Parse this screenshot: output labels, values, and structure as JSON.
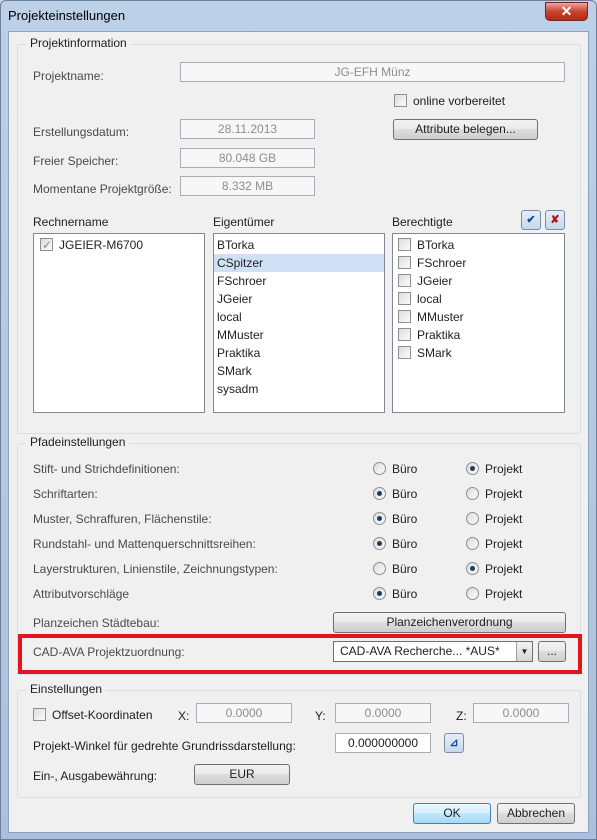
{
  "window": {
    "title": "Projekteinstellungen",
    "close_glyph": "✕"
  },
  "projektinfo": {
    "legend": "Projektinformation",
    "projektname_label": "Projektname:",
    "projektname_value": "JG-EFH Münz",
    "online_label": "online vorbereitet",
    "erstellungsdatum_label": "Erstellungsdatum:",
    "erstellungsdatum_value": "28.11.2013",
    "attribute_button": "Attribute belegen...",
    "freier_speicher_label": "Freier Speicher:",
    "freier_speicher_value": "80.048 GB",
    "projektgroesse_label": "Momentane Projektgröße:",
    "projektgroesse_value": "8.332 MB",
    "rechnername_header": "Rechnername",
    "eigentuemer_header": "Eigentümer",
    "berechtigte_header": "Berechtigte",
    "rechner": [
      "JGEIER-M6700"
    ],
    "eigentuemer": [
      "BTorka",
      "CSpitzer",
      "FSchroer",
      "JGeier",
      "local",
      "MMuster",
      "Praktika",
      "SMark",
      "sysadm"
    ],
    "eigentuemer_selected": "CSpitzer",
    "berechtigte": [
      "BTorka",
      "FSchroer",
      "JGeier",
      "local",
      "MMuster",
      "Praktika",
      "SMark"
    ]
  },
  "pfade": {
    "legend": "Pfadeinstellungen",
    "option_buero": "Büro",
    "option_projekt": "Projekt",
    "rows": [
      {
        "label": "Stift- und Strichdefinitionen:",
        "selected": "Projekt"
      },
      {
        "label": "Schriftarten:",
        "selected": "Büro"
      },
      {
        "label": "Muster, Schraffuren, Flächenstile:",
        "selected": "Büro"
      },
      {
        "label": "Rundstahl- und Mattenquerschnittsreihen:",
        "selected": "Büro"
      },
      {
        "label": "Layerstrukturen, Linienstile, Zeichnungstypen:",
        "selected": "Projekt"
      },
      {
        "label": "Attributvorschläge",
        "selected": "Büro"
      }
    ],
    "planzeichen_label": "Planzeichen Städtebau:",
    "planzeichen_button": "Planzeichenverordnung",
    "cadava_label": "CAD-AVA Projektzuordnung:",
    "cadava_value": "CAD-AVA Recherche... *AUS*",
    "cadava_more": "...",
    "highlight_color": "#e3141e"
  },
  "einstellungen": {
    "legend": "Einstellungen",
    "offset_label": "Offset-Koordinaten",
    "x_label": "X:",
    "x_value": "0.0000",
    "y_label": "Y:",
    "y_value": "0.0000",
    "z_label": "Z:",
    "z_value": "0.0000",
    "winkel_label": "Projekt-Winkel für gedrehte Grundrissdarstellung:",
    "winkel_value": "0.000000000",
    "waehrung_label": "Ein-, Ausgabewährung:",
    "waehrung_button": "EUR"
  },
  "footer": {
    "ok": "OK",
    "abbrechen": "Abbrechen"
  }
}
